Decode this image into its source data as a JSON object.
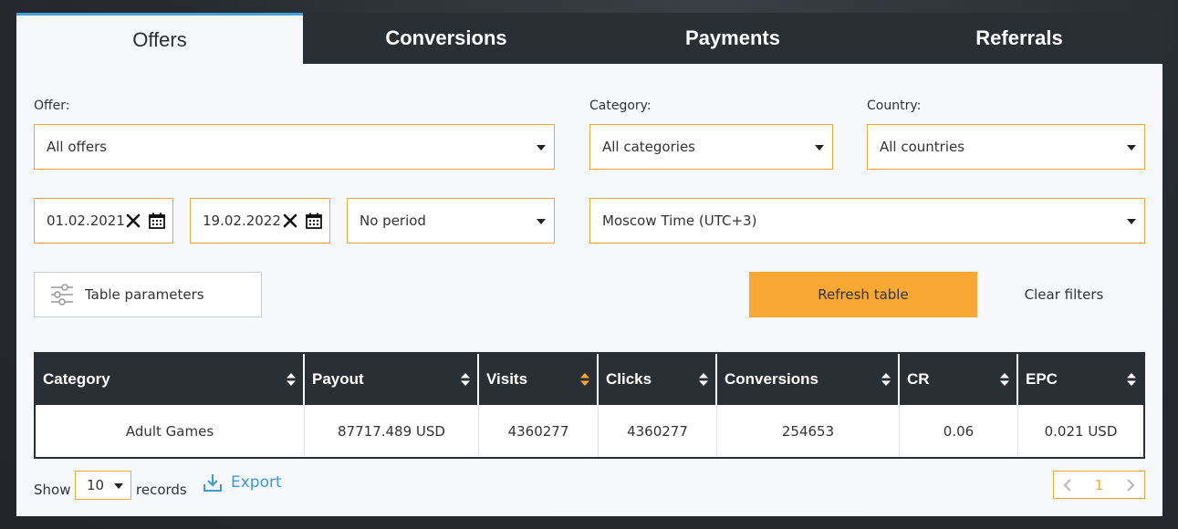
{
  "tabs": [
    {
      "label": "Offers",
      "active": true
    },
    {
      "label": "Conversions",
      "active": false
    },
    {
      "label": "Payments",
      "active": false
    },
    {
      "label": "Referrals",
      "active": false
    }
  ],
  "filters": {
    "offer_label": "Offer:",
    "offer_value": "All offers",
    "category_label": "Category:",
    "category_value": "All categories",
    "country_label": "Country:",
    "country_value": "All countries",
    "date_from": "01.02.2021",
    "date_to": "19.02.2022",
    "period_value": "No period",
    "timezone_value": "Moscow Time (UTC+3)"
  },
  "actions": {
    "table_parameters": "Table parameters",
    "refresh_table": "Refresh table",
    "clear_filters": "Clear filters"
  },
  "table": {
    "columns": [
      "Category",
      "Payout",
      "Visits",
      "Clicks",
      "Conversions",
      "CR",
      "EPC"
    ],
    "active_sort_column": "Visits",
    "rows": [
      [
        "Adult Games",
        "87717.489 USD",
        "4360277",
        "4360277",
        "254653",
        "0.06",
        "0.021 USD"
      ]
    ]
  },
  "footer": {
    "show_label": "Show",
    "page_size": "10",
    "records_label": "records",
    "export_label": "Export",
    "current_page": "1"
  },
  "colors": {
    "accent": "#f9a834",
    "dark": "#2a2e35",
    "link": "#3a9ad9",
    "active_tab_border": "#4a9fd5"
  },
  "icons": [
    "clear-date-icon",
    "calendar-icon",
    "sliders-icon",
    "sort-icon",
    "download-icon",
    "chevron-left-icon",
    "chevron-right-icon",
    "caret-down-icon"
  ]
}
